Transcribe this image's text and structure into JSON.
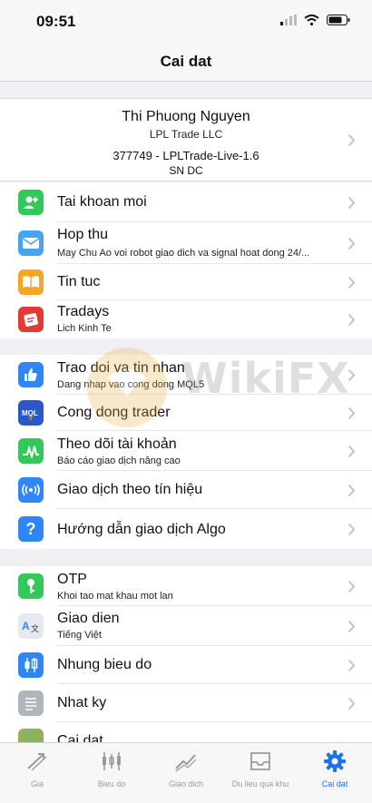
{
  "status": {
    "time": "09:51"
  },
  "nav": {
    "title": "Cai dat"
  },
  "account": {
    "name": "Thi Phuong Nguyen",
    "broker": "LPL Trade LLC",
    "login": "377749 - LPLTrade-Live-1.6",
    "server": "SN DC"
  },
  "menu": {
    "new_account": {
      "label": "Tai khoan moi"
    },
    "mailbox": {
      "label": "Hop thu",
      "sub": "May Chu Ao voi robot giao dich va signal hoat dong 24/..."
    },
    "news": {
      "label": "Tin tuc"
    },
    "tradays": {
      "label": "Tradays",
      "sub": "Lich Kinh Te"
    },
    "chat": {
      "label": "Trao doi va tin nhan",
      "sub": "Dang nhap vao cong dong MQL5"
    },
    "community": {
      "label": "Cong dong trader"
    },
    "monitoring": {
      "label": "Theo dõi tài khoản",
      "sub": "Báo cáo giao dịch nâng cao"
    },
    "signals": {
      "label": "Giao dịch theo tín hiệu"
    },
    "algo": {
      "label": "Hướng dẫn giao dịch Algo"
    },
    "otp": {
      "label": "OTP",
      "sub": "Khoi tao mat khau mot lan"
    },
    "interface": {
      "label": "Giao dien",
      "sub": "Tiếng Việt"
    },
    "charts": {
      "label": "Nhung bieu do"
    },
    "journal": {
      "label": "Nhat ky"
    },
    "settings": {
      "label": "Cai dat"
    }
  },
  "tabs": {
    "quotes": "Gia",
    "chart": "Bieu do",
    "trade": "Giao dich",
    "history": "Du lieu qua khu",
    "settings": "Cai dat"
  },
  "watermark": {
    "text": "WikiFX"
  },
  "colors": {
    "accent": "#1a73e8",
    "green": "#34c759",
    "blue": "#2f86f6",
    "orange": "#f5a623",
    "red": "#e53935",
    "gray": "#b0b4bd"
  }
}
